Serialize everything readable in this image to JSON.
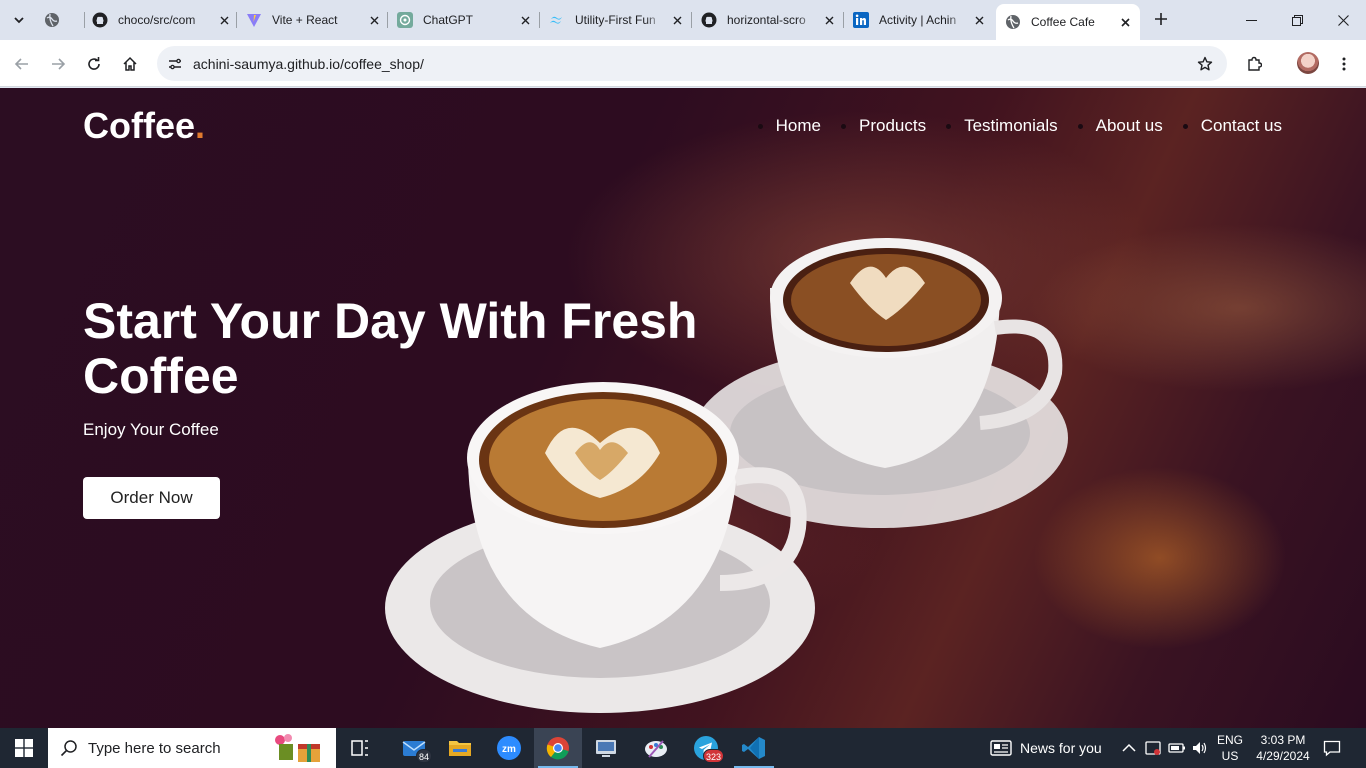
{
  "browser": {
    "tabs": [
      {
        "label": "",
        "icon": "globe-icon"
      },
      {
        "label": "choco/src/com",
        "icon": "github-icon"
      },
      {
        "label": "Vite + React",
        "icon": "vite-icon"
      },
      {
        "label": "ChatGPT",
        "icon": "chatgpt-icon"
      },
      {
        "label": "Utility-First Fun",
        "icon": "tailwind-icon"
      },
      {
        "label": "horizontal-scro",
        "icon": "github-icon"
      },
      {
        "label": "Activity | Achin",
        "icon": "linkedin-icon"
      },
      {
        "label": "Coffee Cafe",
        "icon": "globe-icon",
        "active": true
      }
    ],
    "url": "achini-saumya.github.io/coffee_shop/"
  },
  "page": {
    "logo": {
      "text": "Coffee",
      "dot": "."
    },
    "nav": [
      "Home",
      "Products",
      "Testimonials",
      "About us",
      "Contact us"
    ],
    "hero": {
      "title": "Start Your Day With Fresh Coffee",
      "subtitle": "Enjoy Your Coffee",
      "button": "Order Now"
    },
    "colors": {
      "accent": "#e07a2e",
      "background": "#2c0d22"
    }
  },
  "taskbar": {
    "search_placeholder": "Type here to search",
    "mail_badge": "84",
    "telegram_badge": "323",
    "news": "News for you",
    "lang_line1": "ENG",
    "lang_line2": "US",
    "time": "3:03 PM",
    "date": "4/29/2024"
  }
}
